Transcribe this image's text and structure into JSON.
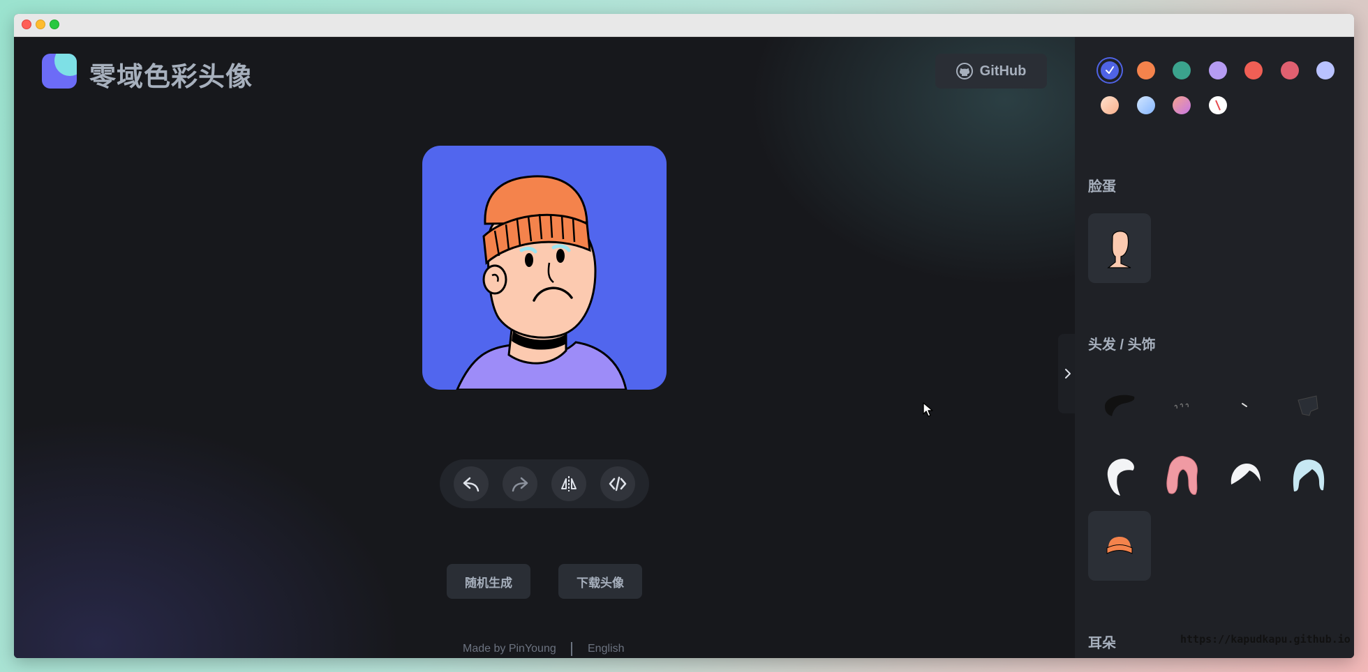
{
  "app": {
    "title": "零域色彩头像",
    "github_label": "GitHub"
  },
  "toolbar": {
    "undo": "undo-icon",
    "redo": "redo-icon",
    "flip": "flip-icon",
    "code": "code-icon"
  },
  "actions": {
    "random_label": "随机生成",
    "download_label": "下载头像"
  },
  "footer": {
    "credit": "Made by PinYoung",
    "language": "English"
  },
  "colors": {
    "accent": "#4f63e6",
    "avatar_background": "#5166ee",
    "swatches": [
      "#4f63e6",
      "#f4834c",
      "#3ba38d",
      "#b69cf3",
      "#f05f55",
      "#e06070",
      "#b9c2ff",
      "#fcc3a6",
      "#a6c8ff",
      "#f08ab0",
      "#ffffff"
    ]
  },
  "panel": {
    "sections": [
      {
        "title": "脸蛋"
      },
      {
        "title": "头发 / 头饰"
      },
      {
        "title": "耳朵"
      }
    ]
  },
  "watermark": "https://kapudkapu.github.io"
}
